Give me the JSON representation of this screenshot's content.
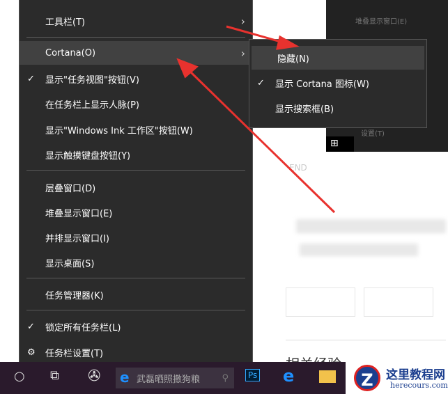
{
  "main_menu": {
    "items": [
      {
        "label": "工具栏(T)",
        "submenu": true
      },
      {
        "label": "Cortana(O)",
        "submenu": true,
        "highlighted": true
      },
      {
        "label": "显示\"任务视图\"按钮(V)",
        "checked": true
      },
      {
        "label": "在任务栏上显示人脉(P)"
      },
      {
        "label": "显示\"Windows Ink 工作区\"按钮(W)"
      },
      {
        "label": "显示触摸键盘按钮(Y)"
      },
      {
        "label": "层叠窗口(D)"
      },
      {
        "label": "堆叠显示窗口(E)"
      },
      {
        "label": "并排显示窗口(I)"
      },
      {
        "label": "显示桌面(S)"
      },
      {
        "label": "任务管理器(K)"
      },
      {
        "label": "锁定所有任务栏(L)",
        "checked": true
      },
      {
        "label": "任务栏设置(T)",
        "icon": "gear-icon"
      }
    ]
  },
  "cortana_submenu": {
    "items": [
      {
        "label": "隐藏(N)",
        "highlighted": true
      },
      {
        "label": "显示 Cortana 图标(W)",
        "checked": true
      },
      {
        "label": "显示搜索框(B)"
      }
    ]
  },
  "background": {
    "end_text": "END",
    "partial_heading": "相关经验",
    "bg_menu_item": "堆叠显示窗口(E)",
    "bg_settings": "设置(T)"
  },
  "taskbar": {
    "search_text": "武磊晒照撒狗粮"
  },
  "watermark": {
    "title": "这里教程网",
    "url": "herecours.com"
  },
  "colors": {
    "menu_bg": "#2b2b2b",
    "highlight": "#414141",
    "arrow": "#e8322e",
    "taskbar": "#2a1a2c"
  }
}
